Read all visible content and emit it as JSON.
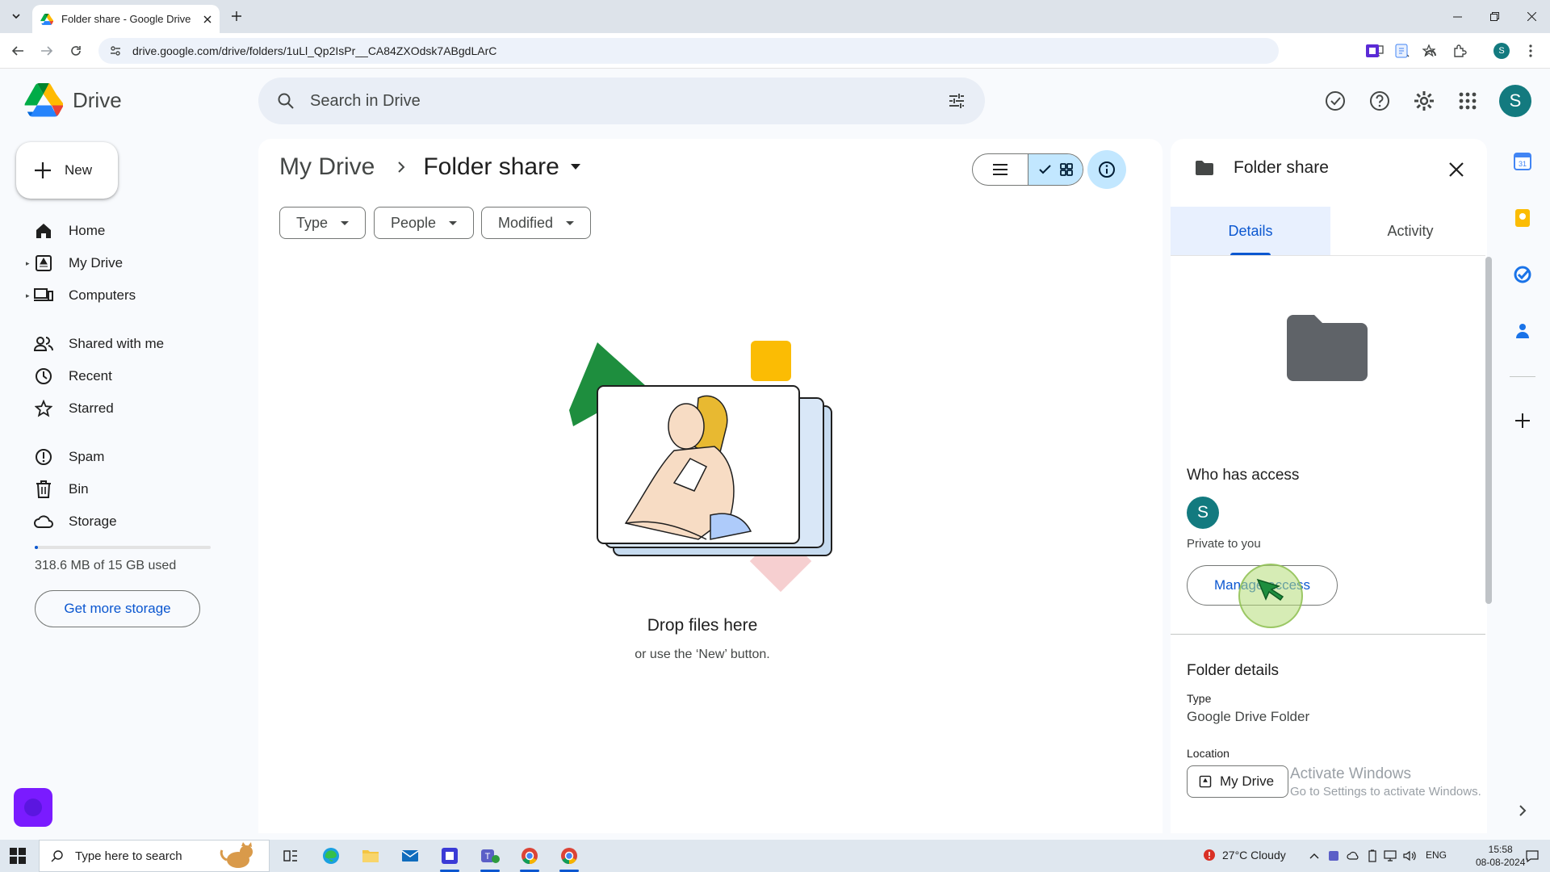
{
  "browser": {
    "tab_title": "Folder share - Google Drive",
    "url": "drive.google.com/drive/folders/1uLl_Qp2IsPr__CA84ZXOdsk7ABgdLArC",
    "profile_initial": "S"
  },
  "drive": {
    "app_name": "Drive",
    "search_placeholder": "Search in Drive",
    "user_initial": "S"
  },
  "sidebar": {
    "new_label": "New",
    "items": [
      {
        "label": "Home",
        "icon": "home-icon"
      },
      {
        "label": "My Drive",
        "icon": "my-drive-icon"
      },
      {
        "label": "Computers",
        "icon": "computers-icon"
      },
      {
        "label": "Shared with me",
        "icon": "shared-icon"
      },
      {
        "label": "Recent",
        "icon": "clock-icon"
      },
      {
        "label": "Starred",
        "icon": "star-icon"
      },
      {
        "label": "Spam",
        "icon": "spam-icon"
      },
      {
        "label": "Bin",
        "icon": "bin-icon"
      },
      {
        "label": "Storage",
        "icon": "cloud-icon"
      }
    ],
    "storage_used_fraction": 0.02,
    "storage_text": "318.6 MB of 15 GB used",
    "get_storage_label": "Get more storage"
  },
  "main": {
    "breadcrumb_root": "My Drive",
    "breadcrumb_current": "Folder share",
    "filters": [
      "Type",
      "People",
      "Modified"
    ],
    "empty_title": "Drop files here",
    "empty_subtitle": "or use the ‘New’ button."
  },
  "details": {
    "title": "Folder share",
    "tabs": [
      "Details",
      "Activity"
    ],
    "who_has_access": "Who has access",
    "access_initial": "S",
    "private_text": "Private to you",
    "manage_access_label": "Manage access",
    "folder_details_title": "Folder details",
    "type_label": "Type",
    "type_value": "Google Drive Folder",
    "location_label": "Location",
    "location_value": "My Drive"
  },
  "watermark": {
    "line1": "Activate Windows",
    "line2": "Go to Settings to activate Windows."
  },
  "taskbar": {
    "search_placeholder": "Type here to search",
    "weather": "27°C  Cloudy",
    "language": "ENG",
    "time": "15:58",
    "date": "08-08-2024"
  },
  "colors": {
    "accent": "#0b57d0",
    "selected_bg": "#c2e7ff",
    "avatar": "#137a7f"
  }
}
